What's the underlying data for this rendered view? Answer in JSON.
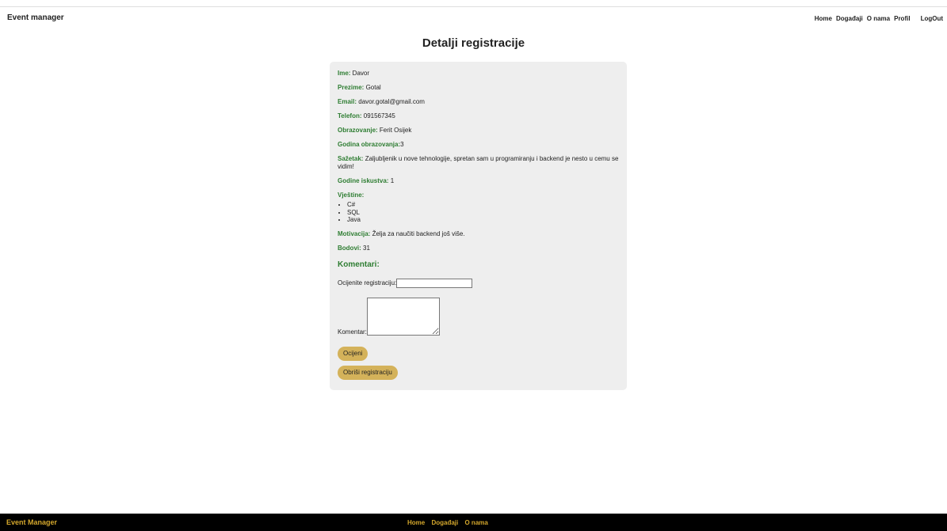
{
  "header": {
    "brand": "Event manager",
    "nav": [
      "Home",
      "Događaji",
      "O nama",
      "Profil",
      "LogOut"
    ]
  },
  "page": {
    "title": "Detalji registracije"
  },
  "details": {
    "ime_label": "Ime:",
    "ime": " Davor",
    "prezime_label": "Prezime:",
    "prezime": " Gotal",
    "email_label": "Email:",
    "email": " davor.gotal@gmail.com",
    "telefon_label": "Telefon:",
    "telefon": " 091567345",
    "obrazovanje_label": "Obrazovanje:",
    "obrazovanje": " Ferit Osijek",
    "godina_label": "Godina obrazovanja:",
    "godina": "3",
    "sazetak_label": "Sažetak:",
    "sazetak": " Zaljubljenik u nove tehnologije, spretan sam u programiranju i backend je nesto u cemu se vidim!",
    "iskustvo_label": "Godine iskustva:",
    "iskustvo": " 1",
    "vjestine_label": "Vještine:",
    "vjestine": [
      "C#",
      "SQL",
      "Java"
    ],
    "motivacija_label": "Motivacija:",
    "motivacija": " Želja za naučiti backend još više.",
    "bodovi_label": "Bodovi:",
    "bodovi": " 31"
  },
  "comments": {
    "heading": "Komentari:",
    "rating_label": "Ocijenite registraciju:",
    "rating_value": "",
    "comment_label": "Komentar:",
    "comment_value": ""
  },
  "buttons": {
    "rate": "Ocijeni",
    "delete": "Obriši registraciju"
  },
  "footer": {
    "brand": "Event Manager",
    "links": [
      "Home",
      "Događaji",
      "O nama"
    ]
  }
}
